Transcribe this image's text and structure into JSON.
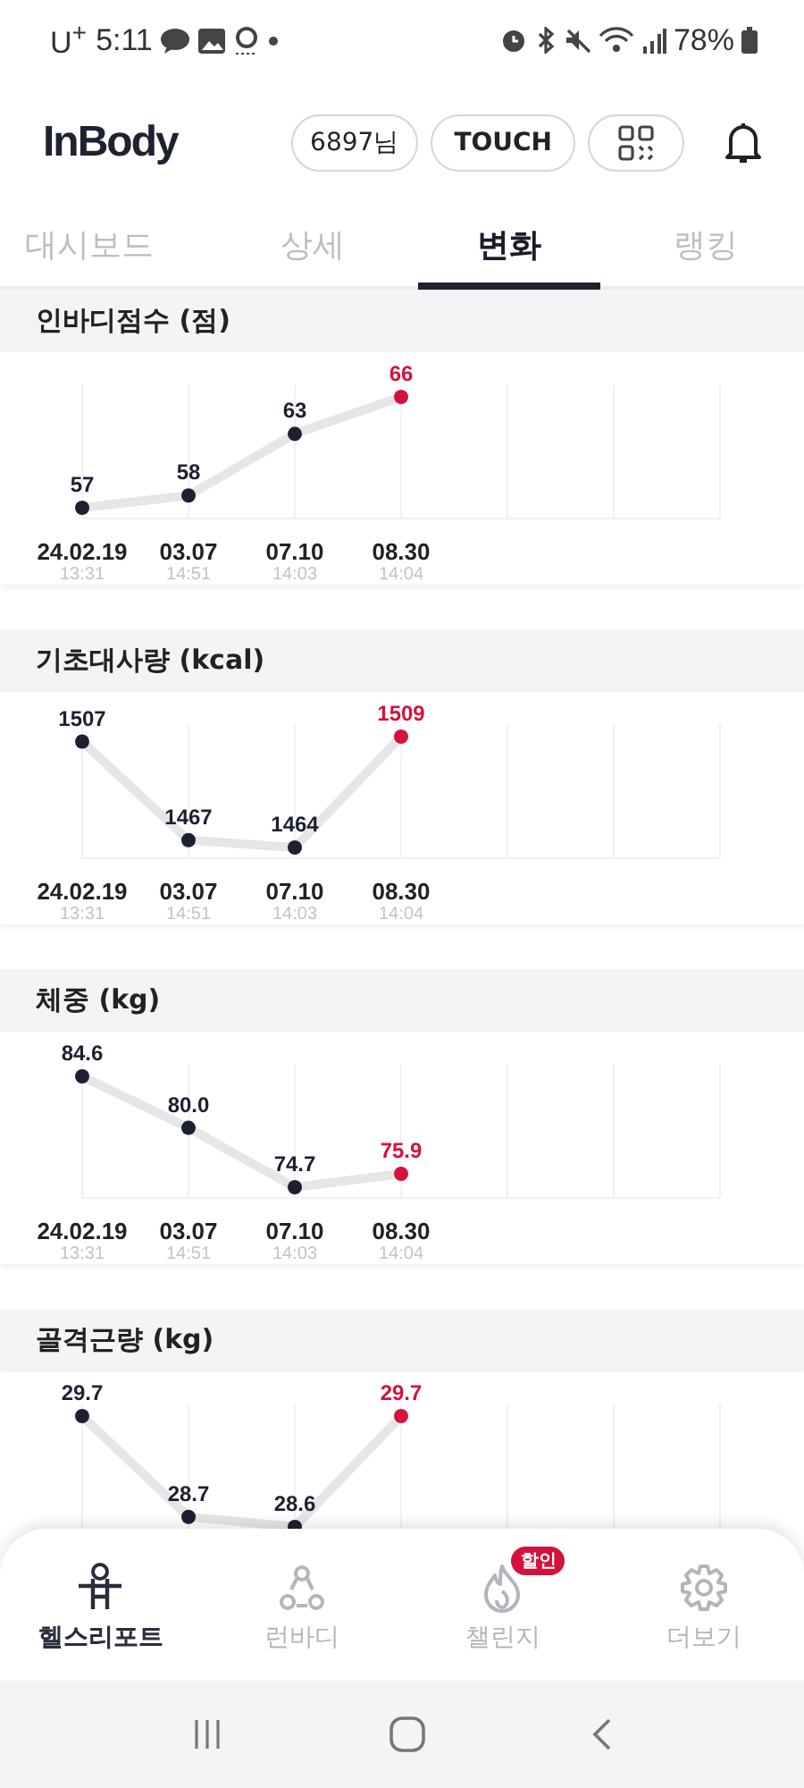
{
  "status_bar": {
    "carrier": "U$^{+}$",
    "time": "5:11",
    "battery": "78%"
  },
  "header": {
    "logo": "InBody",
    "user": "6897님",
    "touch": "TOUCH"
  },
  "tabs": [
    {
      "label": "대시보드",
      "selected": false
    },
    {
      "label": "상세",
      "selected": false
    },
    {
      "label": "변화",
      "selected": true
    },
    {
      "label": "랭킹",
      "selected": false
    }
  ],
  "sections": [
    {
      "title": "인바디점수 (점)",
      "latest_point": {
        "color": "#d4123b"
      },
      "times": [
        "13:31",
        "14:51",
        "14:03",
        "14:04"
      ],
      "chart_data": {
        "type": "line",
        "categories": [
          "24.02.19",
          "03.07",
          "07.10",
          "08.30"
        ],
        "grid": true,
        "series": [
          {
            "color": "#1d2030",
            "marker": true,
            "values": [
              57,
              58,
              63,
              66
            ]
          }
        ],
        "data_labels": true
      }
    },
    {
      "title": "기초대사량 (kcal)",
      "latest_point": {
        "color": "#d4123b"
      },
      "times": [
        "13:31",
        "14:51",
        "14:03",
        "14:04"
      ],
      "chart_data": {
        "type": "line",
        "categories": [
          "24.02.19",
          "03.07",
          "07.10",
          "08.30"
        ],
        "grid": true,
        "series": [
          {
            "color": "#1d2030",
            "marker": true,
            "values": [
              1507,
              1467,
              1464,
              1509
            ]
          }
        ],
        "data_labels": true
      }
    },
    {
      "title": "체중 (kg)",
      "latest_point": {
        "color": "#d4123b"
      },
      "times": [
        "13:31",
        "14:51",
        "14:03",
        "14:04"
      ],
      "chart_data": {
        "type": "line",
        "categories": [
          "24.02.19",
          "03.07",
          "07.10",
          "08.30"
        ],
        "grid": true,
        "series": [
          {
            "color": "#1d2030",
            "marker": true,
            "values": [
              84.6,
              80.0,
              74.7,
              75.9
            ],
            "value_labels": [
              "84.6",
              "80.0",
              "74.7",
              "75.9"
            ]
          }
        ],
        "data_labels": true
      }
    },
    {
      "title": "골격근량 (kg)",
      "latest_point": {
        "color": "#d4123b"
      },
      "chart_data": {
        "type": "line",
        "grid": true,
        "series": [
          {
            "color": "#1d2030",
            "marker": true,
            "values": [
              29.7,
              28.7,
              28.6,
              29.7
            ]
          }
        ],
        "data_labels": true
      }
    }
  ],
  "bottom_nav": [
    {
      "label": "헬스리포트",
      "selected": true
    },
    {
      "label": "런바디",
      "selected": false
    },
    {
      "label": "챌린지",
      "selected": false,
      "badge": "할인"
    },
    {
      "label": "더보기",
      "selected": false
    }
  ]
}
